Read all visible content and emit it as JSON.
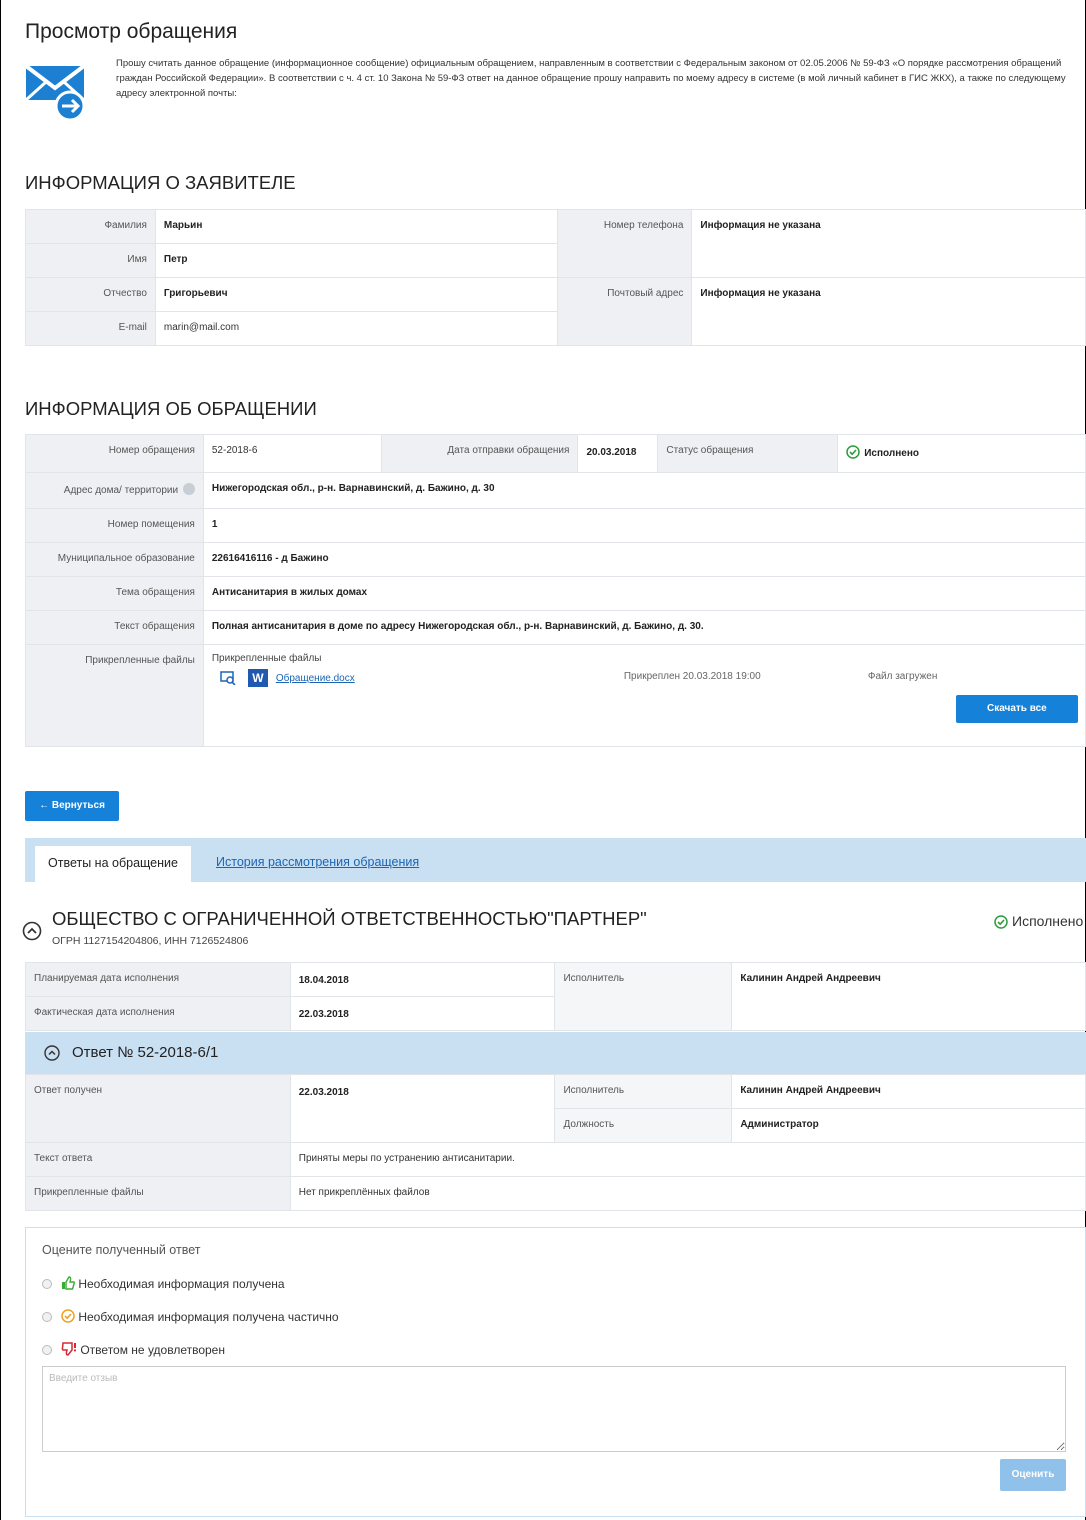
{
  "page": {
    "title": "Просмотр обращения",
    "intro": "Прошу считать данное обращение (информационное сообщение) официальным обращением, направленным в соответствии с Федеральным законом от 02.05.2006 № 59-ФЗ «О порядке рассмотрения обращений граждан Российской Федерации». В соответствии с ч. 4 ст. 10 Закона № 59-ФЗ ответ на данное обращение прошу направить по моему адресу в системе (в мой личный кабинет в ГИС ЖКХ), а также по следующему адресу электронной почты:"
  },
  "applicant": {
    "section_title": "ИНФОРМАЦИЯ О ЗАЯВИТЕЛЕ",
    "surname_label": "Фамилия",
    "surname": "Марьин",
    "name_label": "Имя",
    "name": "Петр",
    "patronymic_label": "Отчество",
    "patronymic": "Григорьевич",
    "email_label": "E-mail",
    "email": "marin@mail.com",
    "phone_label": "Номер телефона",
    "phone": "Информация не указана",
    "postal_label": "Почтовый адрес",
    "postal": "Информация не указана"
  },
  "appeal": {
    "section_title": "ИНФОРМАЦИЯ ОБ ОБРАЩЕНИИ",
    "number_label": "Номер обращения",
    "number": "52-2018-6",
    "date_label": "Дата отправки обращения",
    "date": "20.03.2018",
    "status_label": "Статус обращения",
    "status": "Исполнено",
    "address_label": "Адрес дома/ территории",
    "address": "Нижегородская обл., р-н. Варнавинский, д. Бажино, д. 30",
    "room_label": "Номер помещения",
    "room": "1",
    "municipality_label": "Муниципальное образование",
    "municipality": "22616416116 - д Бажино",
    "topic_label": "Тема обращения",
    "topic": "Антисанитария в жилых домах",
    "text_label": "Текст обращения",
    "text": "Полная антисанитария в доме по адресу Нижегородская обл., р-н. Варнавинский, д. Бажино, д. 30.",
    "files_label": "Прикрепленные файлы",
    "files_header": "Прикрепленные файлы",
    "file_name": "Обращение.docx",
    "file_attached": "Прикреплен 20.03.2018 19:00",
    "file_status": "Файл загружен",
    "download_all": "Скачать все"
  },
  "back_button": "← Вернуться",
  "tabs": {
    "answers": "Ответы на обращение",
    "history": "История рассмотрения обращения"
  },
  "org": {
    "title": "ОБЩЕСТВО С ОГРАНИЧЕННОЙ ОТВЕТСТВЕННОСТЬЮ\"ПАРТНЕР\"",
    "sub": "ОГРН 1127154204806, ИНН 7126524806",
    "status": "Исполнено",
    "planned_label": "Планируемая дата исполнения",
    "planned": "18.04.2018",
    "actual_label": "Фактическая дата исполнения",
    "actual": "22.03.2018",
    "executor_label": "Исполнитель",
    "executor": "Калинин Андрей Андреевич"
  },
  "answer": {
    "title": "Ответ № 52-2018-6/1",
    "received_label": "Ответ получен",
    "received": "22.03.2018",
    "executor_label": "Исполнитель",
    "executor": "Калинин Андрей Андреевич",
    "position_label": "Должность",
    "position": "Администратор",
    "text_label": "Текст ответа",
    "text": "Приняты меры по устранению антисанитарии.",
    "files_label": "Прикрепленные файлы",
    "files": "Нет прикреплённых файлов"
  },
  "rating": {
    "title": "Оцените полученный ответ",
    "opt1": "Необходимая информация получена",
    "opt2": "Необходимая информация получена частично",
    "opt3": "Ответом не удовлетворен",
    "placeholder": "Введите отзыв",
    "submit": "Оценить"
  }
}
